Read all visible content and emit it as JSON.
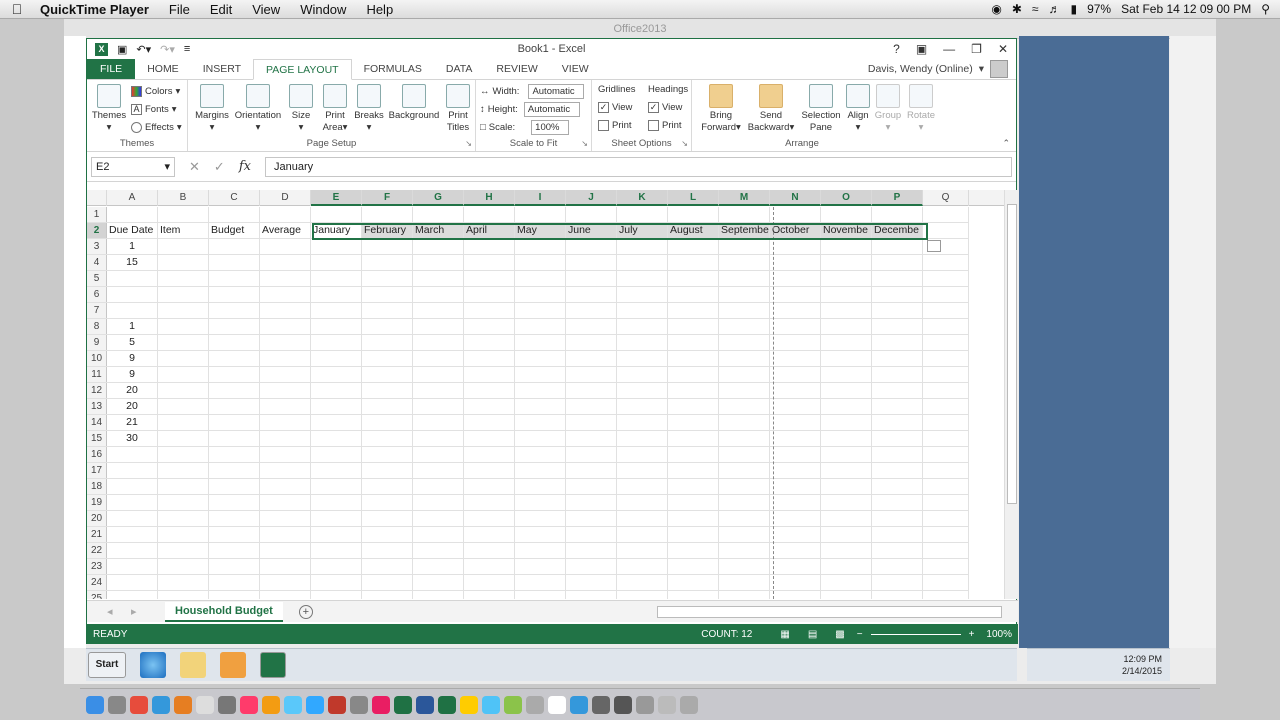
{
  "menubar": {
    "app": "QuickTime Player",
    "items": [
      "File",
      "Edit",
      "View",
      "Window",
      "Help"
    ],
    "battery": "97%",
    "clock": "Sat Feb 14  12 09 00 PM"
  },
  "bg_window": {
    "title": "Office2013"
  },
  "excel": {
    "title": "Book1 - Excel",
    "tabs": [
      "FILE",
      "HOME",
      "INSERT",
      "PAGE LAYOUT",
      "FORMULAS",
      "DATA",
      "REVIEW",
      "VIEW"
    ],
    "active_tab": "PAGE LAYOUT",
    "user": "Davis, Wendy (Online)",
    "ribbon": {
      "themes": {
        "themes": "Themes",
        "colors": "Colors",
        "fonts": "Fonts",
        "effects": "Effects",
        "label": "Themes"
      },
      "page_setup": {
        "margins": "Margins",
        "orientation": "Orientation",
        "size": "Size",
        "print_area_1": "Print",
        "print_area_2": "Area",
        "breaks": "Breaks",
        "background": "Background",
        "print_titles_1": "Print",
        "print_titles_2": "Titles",
        "label": "Page Setup"
      },
      "scale_to_fit": {
        "width_label": "Width:",
        "width_value": "Automatic",
        "height_label": "Height:",
        "height_value": "Automatic",
        "scale_label": "Scale:",
        "scale_value": "100%",
        "label": "Scale to Fit"
      },
      "sheet_options": {
        "gridlines": "Gridlines",
        "headings": "Headings",
        "view": "View",
        "print": "Print",
        "label": "Sheet Options"
      },
      "arrange": {
        "bring_1": "Bring",
        "bring_2": "Forward",
        "send_1": "Send",
        "send_2": "Backward",
        "sel_1": "Selection",
        "sel_2": "Pane",
        "align": "Align",
        "group": "Group",
        "rotate": "Rotate",
        "label": "Arrange"
      }
    },
    "name_box": "E2",
    "formula_fx": "fx",
    "formula_value": "January",
    "columns": [
      "A",
      "B",
      "C",
      "D",
      "E",
      "F",
      "G",
      "H",
      "I",
      "J",
      "K",
      "L",
      "M",
      "N",
      "O",
      "P",
      "Q"
    ],
    "selected_columns": [
      "E",
      "F",
      "G",
      "H",
      "I",
      "J",
      "K",
      "L",
      "M",
      "N",
      "O",
      "P"
    ],
    "row_numbers": [
      "1",
      "2",
      "3",
      "4",
      "5",
      "6",
      "7",
      "8",
      "9",
      "10",
      "11",
      "12",
      "13",
      "14",
      "15",
      "16",
      "17",
      "18",
      "19",
      "20",
      "21",
      "22",
      "23",
      "24",
      "25"
    ],
    "header_row": [
      "Due Date",
      "Item",
      "Budget",
      "Average",
      "January",
      "February",
      "March",
      "April",
      "May",
      "June",
      "July",
      "August",
      "Septembe",
      "October",
      "Novembe",
      "Decembe",
      ""
    ],
    "due_dates": [
      "",
      "",
      "1",
      "15",
      "",
      "",
      "",
      "1",
      "5",
      "9",
      "9",
      "20",
      "20",
      "21",
      "30",
      "",
      "",
      "",
      "",
      "",
      "",
      "",
      "",
      "",
      ""
    ],
    "sheet_tab": "Household Budget",
    "add_sheet": "+",
    "status_ready": "READY",
    "status_count": "COUNT: 12",
    "zoom": "100%"
  },
  "taskbar": {
    "start": "Start",
    "time": "12:09 PM",
    "date": "2/14/2015"
  }
}
